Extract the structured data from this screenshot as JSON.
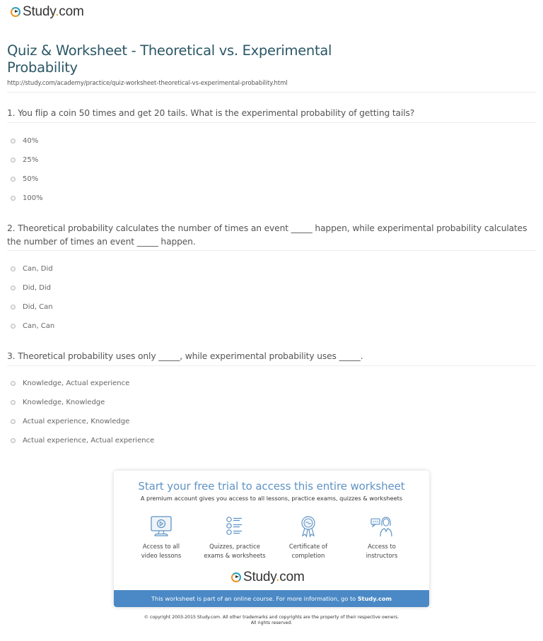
{
  "brand": {
    "name_main": "Study",
    "name_dot": ".",
    "name_tld": "com",
    "accent_orange": "#f0931e",
    "accent_teal": "#2aa0c4"
  },
  "header": {
    "title": "Quiz & Worksheet - Theoretical vs. Experimental Probability",
    "url": "http://study.com/academy/practice/quiz-worksheet-theoretical-vs-experimental-probability.html"
  },
  "questions": [
    {
      "text": "1. You flip a coin 50 times and get 20 tails. What is the experimental probability of getting tails?",
      "options": [
        "40%",
        "25%",
        "50%",
        "100%"
      ]
    },
    {
      "text": "2. Theoretical probability calculates the number of times an event _____ happen, while experimental probability calculates the number of times an event _____ happen.",
      "options": [
        "Can, Did",
        "Did, Did",
        "Did, Can",
        "Can, Can"
      ]
    },
    {
      "text": "3. Theoretical probability uses only _____, while experimental probability uses _____.",
      "options": [
        "Knowledge, Actual experience",
        "Knowledge, Knowledge",
        "Actual experience, Knowledge",
        "Actual experience, Actual experience"
      ]
    }
  ],
  "promo": {
    "title": "Start your free trial to access this entire worksheet",
    "subtitle": "A premium account gives you access to all lessons, practice exams, quizzes & worksheets",
    "features": [
      {
        "icon": "video-monitor-icon",
        "line1": "Access to all",
        "line2": "video lessons"
      },
      {
        "icon": "quiz-list-icon",
        "line1": "Quizzes, practice",
        "line2": "exams & worksheets"
      },
      {
        "icon": "certificate-ribbon-icon",
        "line1": "Certificate of",
        "line2": "completion"
      },
      {
        "icon": "instructor-chat-icon",
        "line1": "Access to",
        "line2": "instructors"
      }
    ],
    "footer_text": "This worksheet is part of an online course. For more information, go to ",
    "footer_link": "Study.com",
    "footer_color": "#4a89c5"
  },
  "copyright": {
    "line1": "© copyright 2003-2015 Study.com. All other trademarks and copyrights are the property of their respective owners.",
    "line2": "All rights reserved."
  }
}
